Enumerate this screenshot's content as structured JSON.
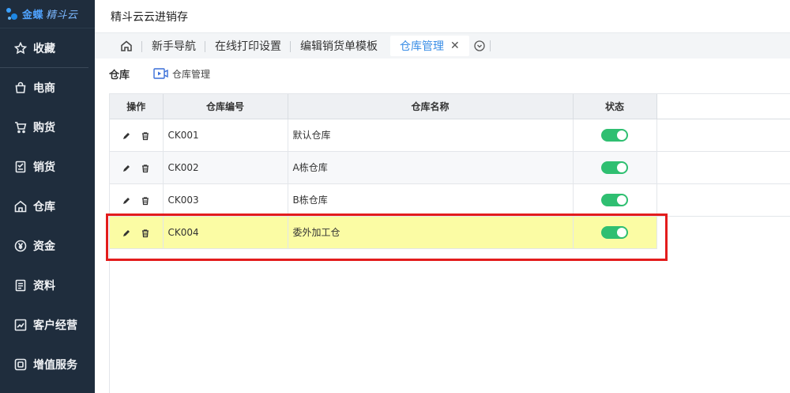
{
  "brand": {
    "name": "金蝶",
    "sub": "精斗云"
  },
  "sidebar": {
    "items": [
      {
        "label": "收藏",
        "icon": "star-icon"
      },
      {
        "label": "电商",
        "icon": "bag-icon"
      },
      {
        "label": "购货",
        "icon": "cart-icon"
      },
      {
        "label": "销货",
        "icon": "sales-doc-icon"
      },
      {
        "label": "仓库",
        "icon": "warehouse-icon"
      },
      {
        "label": "资金",
        "icon": "yuan-icon"
      },
      {
        "label": "资料",
        "icon": "document-icon"
      },
      {
        "label": "客户经营",
        "icon": "chart-icon"
      },
      {
        "label": "增值服务",
        "icon": "service-icon"
      }
    ]
  },
  "header": {
    "title": "精斗云云进销存"
  },
  "tabs": [
    {
      "label": "新手导航"
    },
    {
      "label": "在线打印设置"
    },
    {
      "label": "编辑销货单模板"
    },
    {
      "label": "仓库管理",
      "active": true
    }
  ],
  "page": {
    "title": "仓库",
    "video_link": "仓库管理"
  },
  "table": {
    "columns": [
      "操作",
      "仓库编号",
      "仓库名称",
      "状态"
    ],
    "rows": [
      {
        "code": "CK001",
        "name": "默认仓库",
        "enabled": true
      },
      {
        "code": "CK002",
        "name": "A栋仓库",
        "enabled": true
      },
      {
        "code": "CK003",
        "name": "B栋仓库",
        "enabled": true
      },
      {
        "code": "CK004",
        "name": "委外加工仓",
        "enabled": true
      }
    ]
  },
  "colors": {
    "sidebar_bg": "#1f2d3d",
    "accent": "#3a8ee6",
    "toggle_on": "#2fbf71",
    "highlight": "#fbfca4",
    "annotation": "#e31c1c"
  }
}
